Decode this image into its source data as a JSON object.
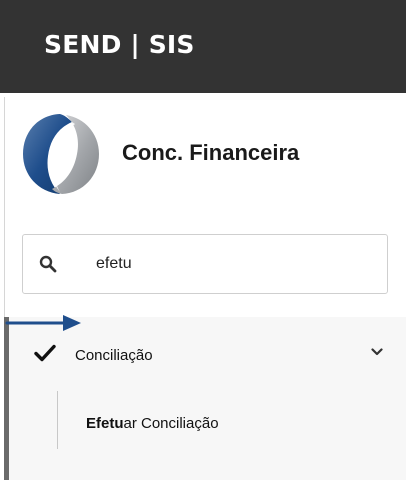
{
  "header": {
    "title": "SEND | SIS"
  },
  "brand": {
    "logo_icon": "brand-logo-icon",
    "name": "Conc. Financeira"
  },
  "search": {
    "icon": "search-icon",
    "value": "efetu"
  },
  "menu": {
    "group": {
      "icon": "check-icon",
      "label": "Conciliação",
      "expanded_icon": "chevron-down-icon",
      "expanded": true
    },
    "items": [
      {
        "label_match": "Efetu",
        "label_rest": "ar Conciliação",
        "highlighted": true
      }
    ]
  },
  "annotation": {
    "icon": "arrow-right-icon",
    "color": "#1f4e8c"
  },
  "colors": {
    "header_bg": "#333333",
    "header_text": "#ffffff",
    "menu_bg": "#f7f7f7",
    "accent": "#1f4e8c"
  }
}
